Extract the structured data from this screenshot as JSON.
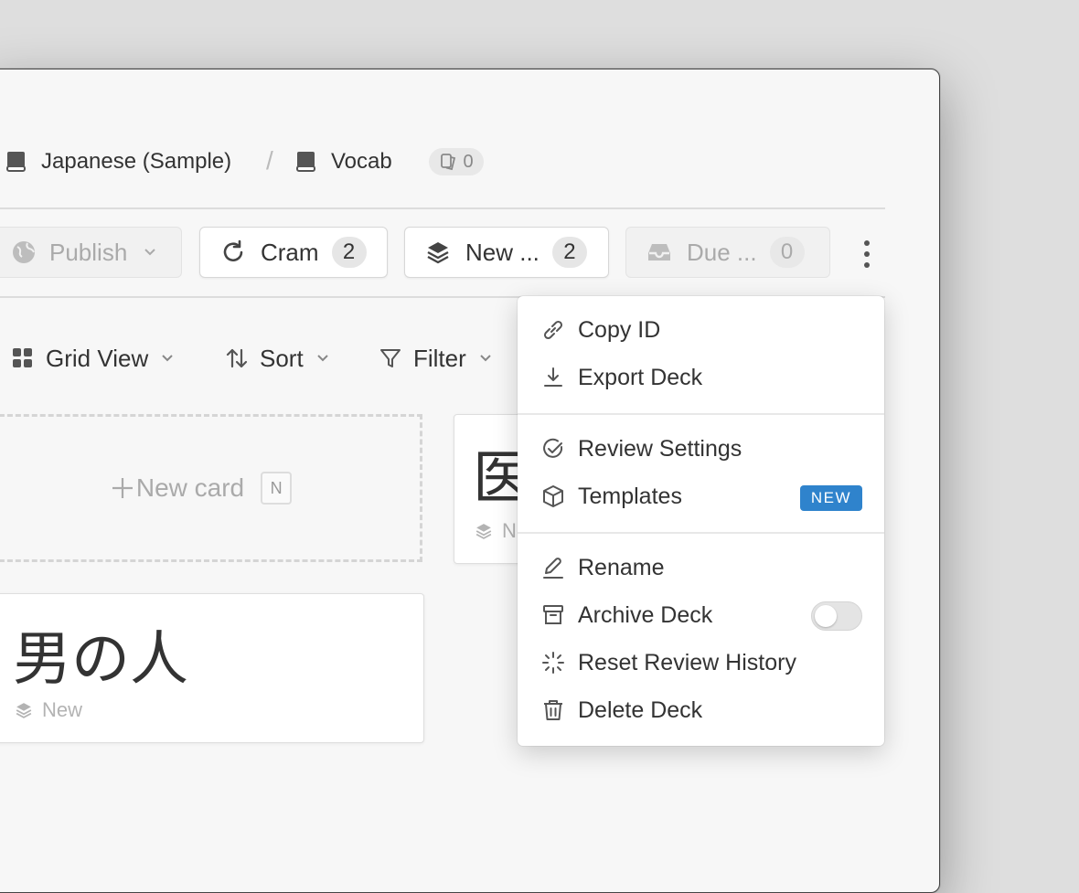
{
  "breadcrumb": {
    "items": [
      {
        "label": "Japanese (Sample)",
        "icon": "book-icon"
      },
      {
        "label": "Vocab",
        "icon": "book-icon"
      }
    ],
    "separator": "/",
    "card_count": "0"
  },
  "toolbar": {
    "publish_label": "Publish",
    "cram": {
      "label": "Cram",
      "count": "2"
    },
    "new": {
      "label": "New ...",
      "count": "2"
    },
    "due": {
      "label": "Due ...",
      "count": "0"
    }
  },
  "view_toolbar": {
    "grid_view_label": "Grid View",
    "sort_label": "Sort",
    "filter_label": "Filter"
  },
  "cards": {
    "new_card_label": "New card",
    "new_card_shortcut": "N",
    "items": [
      {
        "term": "医",
        "status": "N"
      },
      {
        "term": "男の人",
        "status": "New"
      }
    ]
  },
  "menu": {
    "copy_id": "Copy ID",
    "export_deck": "Export Deck",
    "review_settings": "Review Settings",
    "templates": "Templates",
    "templates_tag": "NEW",
    "rename": "Rename",
    "archive_deck": "Archive Deck",
    "archive_on": false,
    "reset_review_history": "Reset Review History",
    "delete_deck": "Delete Deck"
  },
  "colors": {
    "accent": "#2f83cc",
    "window_bg": "#f7f7f7",
    "desktop_bg": "#dedede"
  }
}
